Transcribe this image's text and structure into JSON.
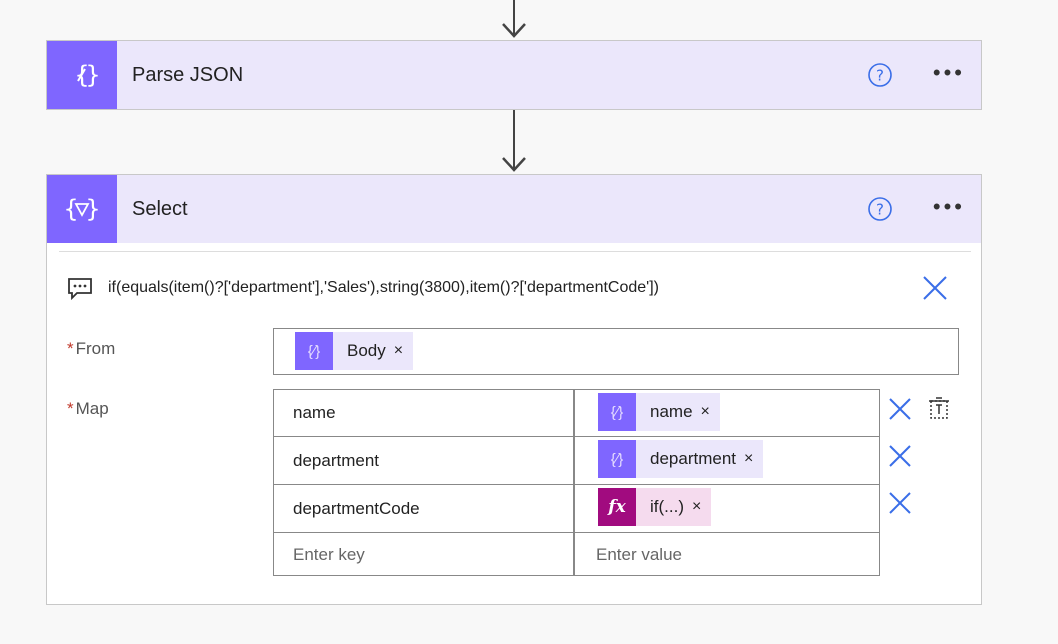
{
  "cards": {
    "parse_json": {
      "title": "Parse JSON",
      "icon": "parse-json-action-icon"
    },
    "select": {
      "title": "Select",
      "icon": "select-action-icon"
    }
  },
  "select": {
    "comment": "if(equals(item()?['department'],'Sales'),string(3800),item()?['departmentCode'])",
    "from_label": "From",
    "map_label": "Map",
    "required_marker": "*",
    "from_token": "Body",
    "token_close": "×",
    "rows": [
      {
        "key": "name",
        "value_token": "name",
        "value_type": "dynamic"
      },
      {
        "key": "department",
        "value_token": "department",
        "value_type": "dynamic"
      },
      {
        "key": "departmentCode",
        "value_token": "if(...)",
        "value_type": "expression"
      }
    ],
    "key_placeholder": "Enter key",
    "value_placeholder": "Enter value"
  },
  "icons": {
    "more": "•••",
    "expression_glyph": "fx",
    "dynamic_glyph": "{⁄}"
  },
  "colors": {
    "accent": "#7f66ff",
    "header_bg": "#ebe7fb",
    "expression": "#a10b7f",
    "close_blue": "#3a6ee8"
  }
}
